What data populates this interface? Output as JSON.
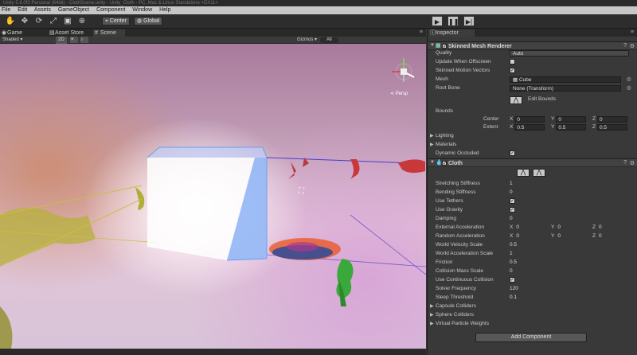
{
  "window": {
    "title": "Unity 5.6.0f3 Personal (64bit) - ClothScene.unity - Unity_Cloth - PC, Mac & Linux Standalone <DX11>"
  },
  "menu": [
    "File",
    "Edit",
    "Assets",
    "GameObject",
    "Component",
    "Window",
    "Help"
  ],
  "toolbar": {
    "center_label": "Center",
    "global_label": "Global"
  },
  "tabs": {
    "game": "Game",
    "asset_store": "Asset Store",
    "scene": "Scene",
    "inspector": "Inspector"
  },
  "scene_toolbar": {
    "shading": "Shaded",
    "mode_2d": "2D",
    "gizmos": "Gizmos",
    "search": "All"
  },
  "scene": {
    "persp_label": "Persp"
  },
  "skinned_mesh_renderer": {
    "title": "Skinned Mesh Renderer",
    "rows": [
      {
        "label": "Quality",
        "value": "Auto"
      },
      {
        "label": "Update When Offscreen",
        "checked": false
      },
      {
        "label": "Skinned Motion Vectors",
        "checked": true
      },
      {
        "label": "Mesh",
        "value": "Cube"
      },
      {
        "label": "Root Bone",
        "value": "None (Transform)"
      }
    ],
    "edit_bounds": "Edit Bounds",
    "bounds_label": "Bounds",
    "center": {
      "label": "Center",
      "x": "0",
      "y": "0",
      "z": "0"
    },
    "extent": {
      "label": "Extent",
      "x": "0.5",
      "y": "0.5",
      "z": "0.5"
    },
    "foldouts": [
      "Lighting",
      "Materials"
    ],
    "dynamic_occluded": {
      "label": "Dynamic Occluded",
      "checked": true
    }
  },
  "cloth": {
    "title": "Cloth",
    "rows": [
      {
        "label": "Stretching Stiffness",
        "value": "1"
      },
      {
        "label": "Bending Stiffness",
        "value": "0"
      },
      {
        "label": "Use Tethers",
        "checked": true
      },
      {
        "label": "Use Gravity",
        "checked": true
      },
      {
        "label": "Damping",
        "value": "0"
      }
    ],
    "external_acceleration": {
      "label": "External Acceleration",
      "x": "0",
      "y": "0",
      "z": "0"
    },
    "random_acceleration": {
      "label": "Random Acceleration",
      "x": "0",
      "y": "0",
      "z": "0"
    },
    "rows2": [
      {
        "label": "World Velocity Scale",
        "value": "0.5"
      },
      {
        "label": "World Acceleration Scale",
        "value": "1"
      },
      {
        "label": "Friction",
        "value": "0.5"
      },
      {
        "label": "Collision Mass Scale",
        "value": "0"
      },
      {
        "label": "Use Continuous Collision",
        "checked": true
      },
      {
        "label": "Solver Frequency",
        "value": "120"
      },
      {
        "label": "Sleep Threshold",
        "value": "0.1"
      }
    ],
    "foldouts": [
      "Capsule Colliders",
      "Sphere Colliders",
      "Virtual Particle Weights"
    ]
  },
  "add_component": "Add Component",
  "colors": {
    "accent_blue": "#5f8ee0",
    "cube_blue": "#4f8af0",
    "red_cloth": "#c8383a",
    "green_cloth": "#3aa83a",
    "yellow_cloth": "#b4b43a"
  }
}
